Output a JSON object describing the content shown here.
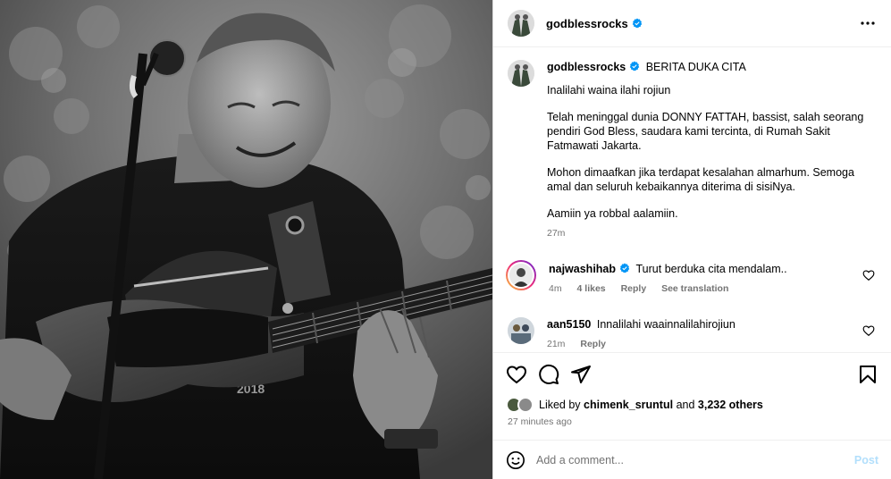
{
  "post": {
    "username": "godblessrocks",
    "more_icon": "more-horizontal-icon",
    "caption": {
      "title": "BERITA DUKA CITA",
      "paragraphs": [
        "Inalilahi waina ilahi rojiun",
        "Telah meninggal dunia DONNY FATTAH, bassist, salah seorang pendiri God Bless, saudara kami tercinta, di Rumah Sakit Fatmawati Jakarta.",
        "Mohon dimaafkan jika terdapat kesalahan almarhum. Semoga amal dan seluruh kebaikannya diterima di sisiNya.",
        "Aamiin ya robbal aalamiin."
      ],
      "time": "27m"
    }
  },
  "comments": [
    {
      "username": "najwashihab",
      "verified": true,
      "text": "Turut berduka cita mendalam..",
      "time": "4m",
      "likes": "4 likes",
      "reply": "Reply",
      "translate": "See translation"
    },
    {
      "username": "aan5150",
      "verified": false,
      "text": "Innalilahi waainnalilahirojiun",
      "time": "21m",
      "reply": "Reply"
    }
  ],
  "actions": {
    "icons": [
      "heart-icon",
      "comment-icon",
      "share-icon",
      "bookmark-icon"
    ],
    "liked_by_prefix": "Liked by",
    "liked_by_user": "chimenk_sruntul",
    "liked_by_and": "and",
    "liked_by_others": "3,232 others",
    "timestamp": "27 minutes ago"
  },
  "add_comment": {
    "placeholder": "Add a comment...",
    "post_label": "Post",
    "emoji_icon": "emoji-icon"
  },
  "colors": {
    "verified": "#0095f6",
    "muted": "#737373",
    "post_disabled": "#b2dffc"
  }
}
